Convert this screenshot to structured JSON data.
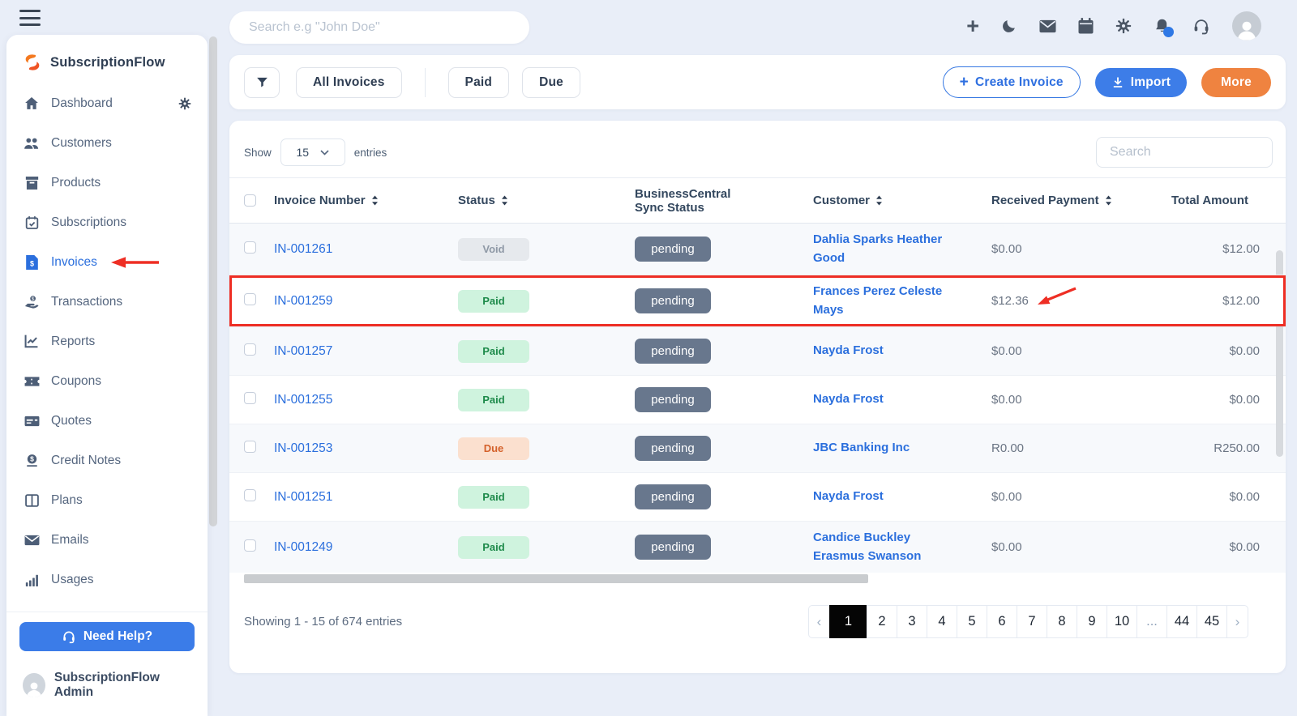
{
  "topbar": {
    "search_placeholder": "Search e.g \"John Doe\"",
    "icons": [
      "plus-icon",
      "moon-icon",
      "mail-icon",
      "calendar-icon",
      "gear-icon",
      "bell-icon",
      "support-icon",
      "avatar"
    ]
  },
  "sidebar": {
    "brand": "SubscriptionFlow",
    "items": [
      {
        "label": "Dashboard",
        "icon": "home-icon",
        "has_gear": true
      },
      {
        "label": "Customers",
        "icon": "users-icon"
      },
      {
        "label": "Products",
        "icon": "products-icon"
      },
      {
        "label": "Subscriptions",
        "icon": "subscriptions-icon"
      },
      {
        "label": "Invoices",
        "icon": "invoices-icon",
        "active": true,
        "arrow": true
      },
      {
        "label": "Transactions",
        "icon": "transactions-icon"
      },
      {
        "label": "Reports",
        "icon": "reports-icon"
      },
      {
        "label": "Coupons",
        "icon": "coupons-icon"
      },
      {
        "label": "Quotes",
        "icon": "quotes-icon"
      },
      {
        "label": "Credit Notes",
        "icon": "credit-notes-icon"
      },
      {
        "label": "Plans",
        "icon": "plans-icon"
      },
      {
        "label": "Emails",
        "icon": "emails-icon"
      },
      {
        "label": "Usages",
        "icon": "usages-icon"
      }
    ],
    "need_help_label": "Need Help?",
    "admin_label": "SubscriptionFlow Admin"
  },
  "toolbar": {
    "filters": [
      "All Invoices",
      "Paid",
      "Due"
    ],
    "create_label": "Create Invoice",
    "import_label": "Import",
    "more_label": "More"
  },
  "table": {
    "show_label": "Show",
    "page_size": "15",
    "entries_label": "entries",
    "search_placeholder": "Search",
    "columns": [
      {
        "label": "Invoice Number",
        "sortable": true
      },
      {
        "label": "Status",
        "sortable": true
      },
      {
        "label": "BusinessCentral Sync Status",
        "sortable": false,
        "wrap": true
      },
      {
        "label": "Customer",
        "sortable": true
      },
      {
        "label": "Received Payment",
        "sortable": true
      },
      {
        "label": "Total Amount",
        "sortable": false
      }
    ],
    "rows": [
      {
        "invoice": "IN-001261",
        "status": "Void",
        "sync": "pending",
        "customer": "Dahlia Sparks Heather Good",
        "received": "$0.00",
        "total": "$12.00"
      },
      {
        "invoice": "IN-001259",
        "status": "Paid",
        "sync": "pending",
        "customer": "Frances Perez Celeste Mays",
        "received": "$12.36",
        "total": "$12.00",
        "highlighted": true,
        "arrow_on_received": true
      },
      {
        "invoice": "IN-001257",
        "status": "Paid",
        "sync": "pending",
        "customer": "Nayda Frost",
        "received": "$0.00",
        "total": "$0.00"
      },
      {
        "invoice": "IN-001255",
        "status": "Paid",
        "sync": "pending",
        "customer": "Nayda Frost",
        "received": "$0.00",
        "total": "$0.00"
      },
      {
        "invoice": "IN-001253",
        "status": "Due",
        "sync": "pending",
        "customer": "JBC Banking Inc",
        "received": "R0.00",
        "total": "R250.00"
      },
      {
        "invoice": "IN-001251",
        "status": "Paid",
        "sync": "pending",
        "customer": "Nayda Frost",
        "received": "$0.00",
        "total": "$0.00"
      },
      {
        "invoice": "IN-001249",
        "status": "Paid",
        "sync": "pending",
        "customer": "Candice Buckley Erasmus Swanson",
        "received": "$0.00",
        "total": "$0.00"
      }
    ]
  },
  "footer": {
    "showing_text": "Showing 1 - 15 of 674 entries",
    "prev_label": "‹",
    "next_label": "›",
    "pages": [
      "1",
      "2",
      "3",
      "4",
      "5",
      "6",
      "7",
      "8",
      "9",
      "10",
      "...",
      "44",
      "45"
    ],
    "active_page": "1"
  },
  "colors": {
    "accent_blue": "#2b6fdd",
    "orange": "#ef8340",
    "highlight_red": "#ee2e24",
    "badge_pending_bg": "#68778d",
    "badge_paid_bg": "#cff3de",
    "badge_due_bg": "#fbe0cf",
    "badge_void_bg": "#e6e9ed"
  }
}
